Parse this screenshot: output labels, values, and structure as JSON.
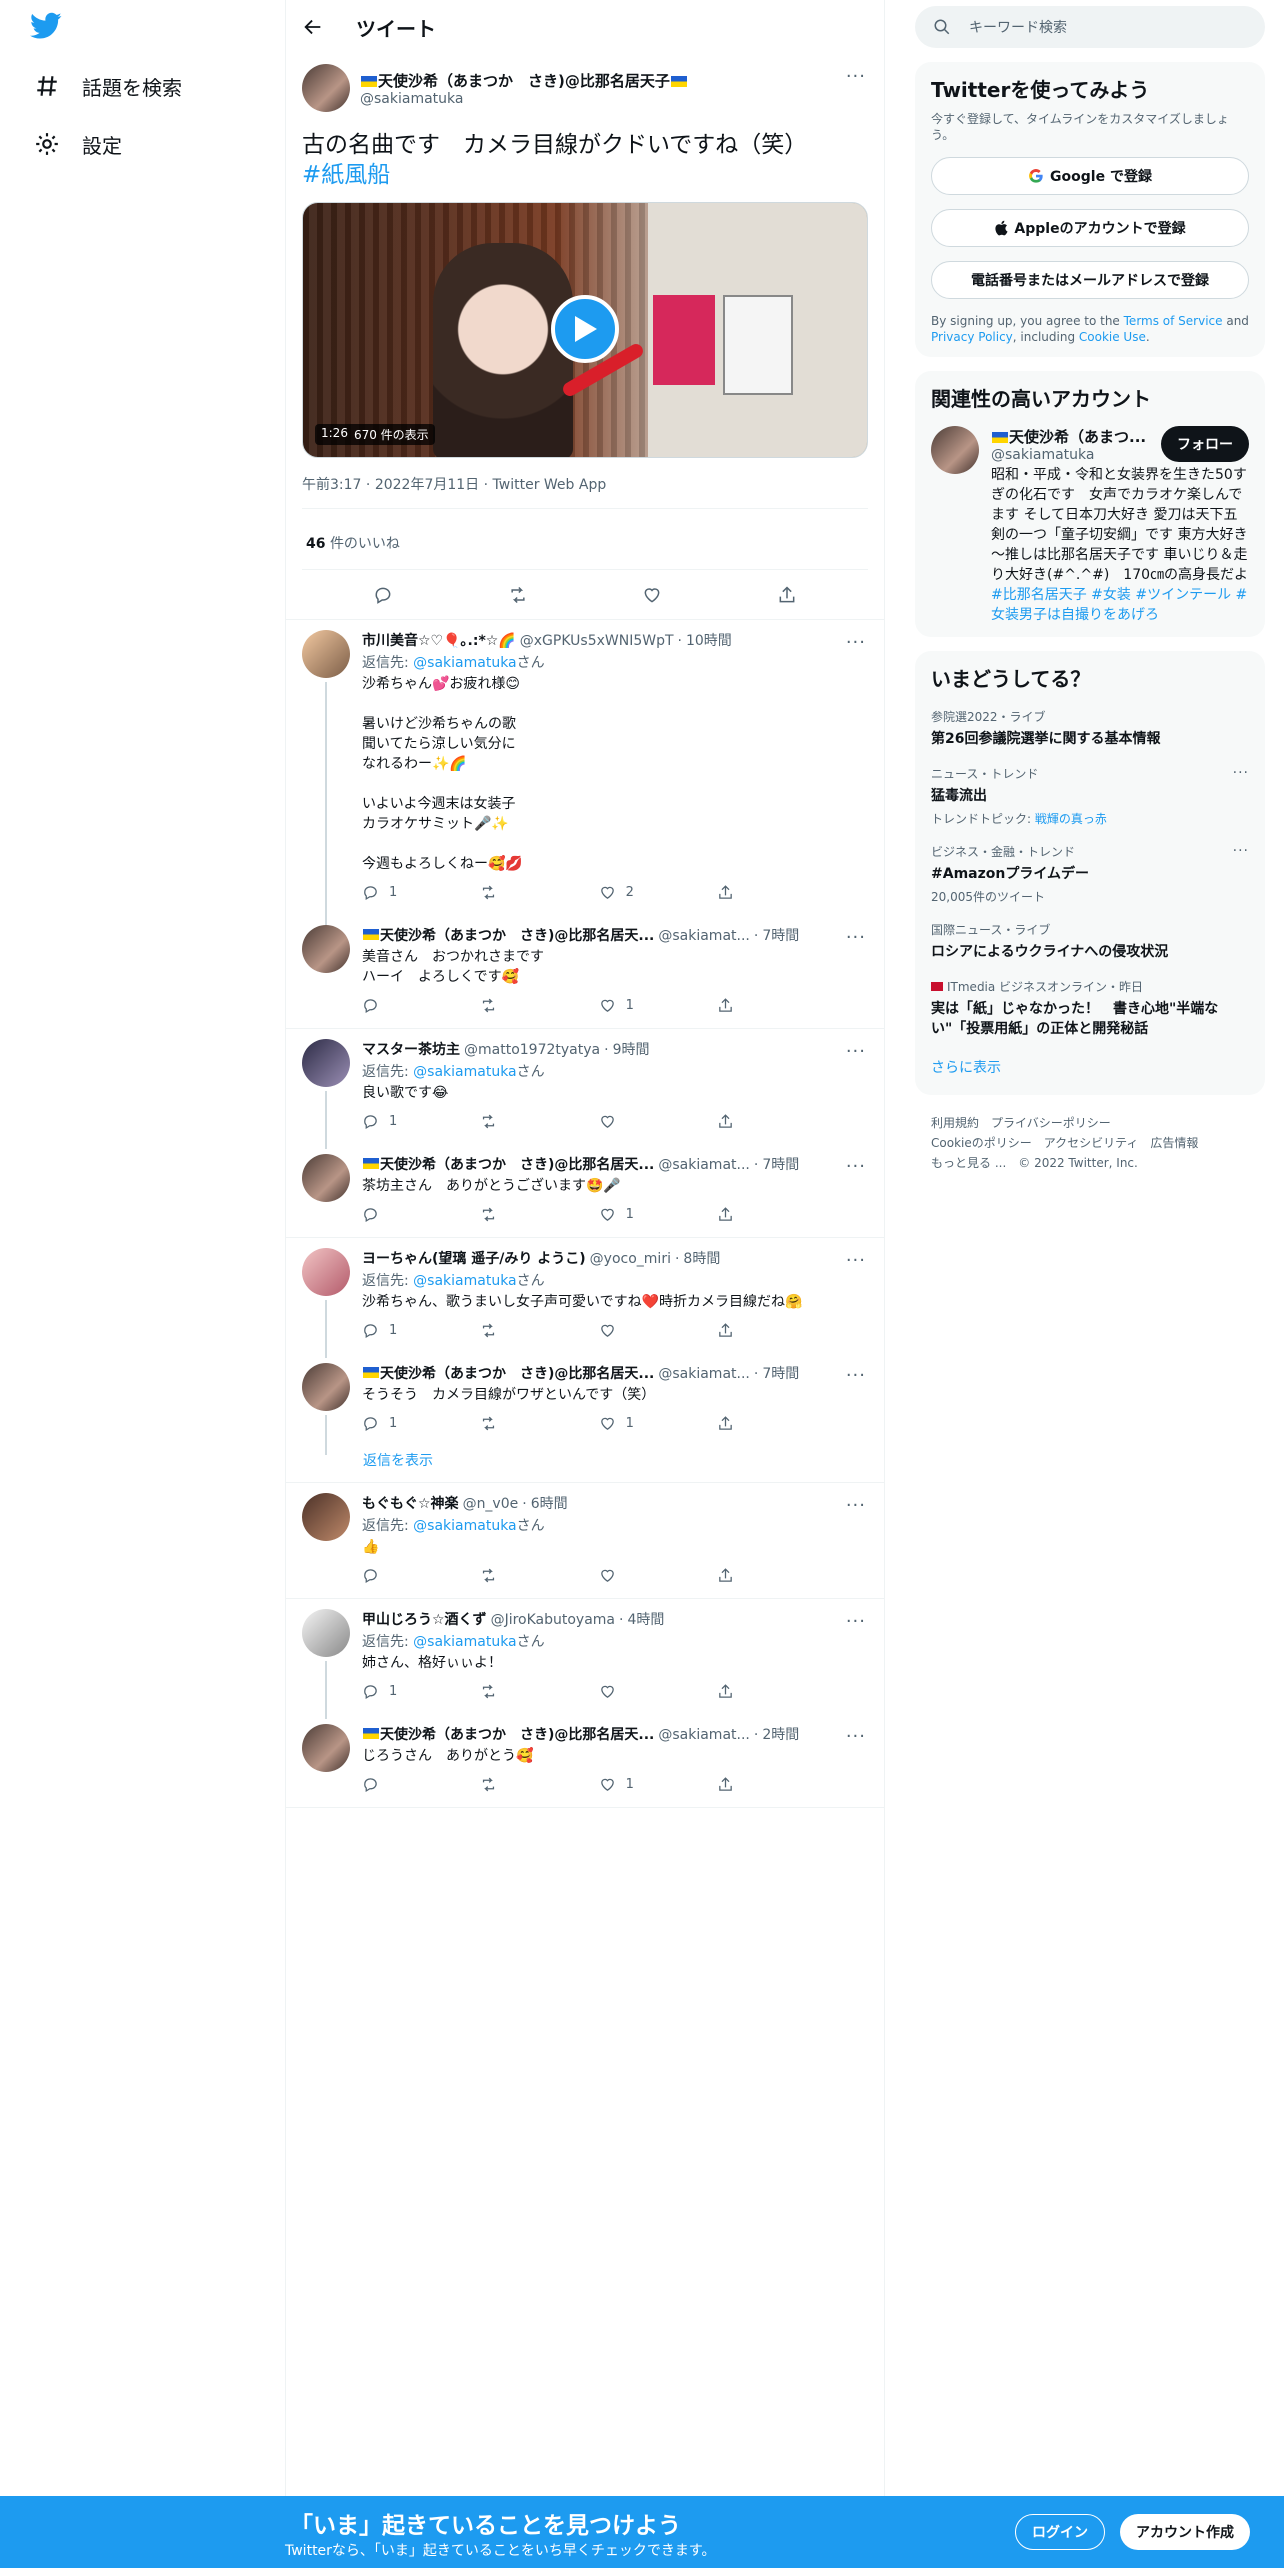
{
  "nav": {
    "explore_label": "話題を検索",
    "settings_label": "設定"
  },
  "header": {
    "title": "ツイート"
  },
  "main_tweet": {
    "author_name": "天使沙希（あまつか　さき)@比那名居天子",
    "author_handle": "@sakiamatuka",
    "text": "古の名曲です　カメラ目線がクドいですね（笑）",
    "hashtag": "#紙風船",
    "video_duration": "1:26",
    "video_views": "670 件の表示",
    "time": "午前3:17",
    "date": "2022年7月11日",
    "source": "Twitter Web App",
    "likes_count": "46",
    "likes_label": "件のいいね"
  },
  "replies": [
    {
      "name": "市川美音☆♡🎈｡.:*☆🌈",
      "handle": "@xGPKUs5xWNI5WpT",
      "time": "10時間",
      "reply_prefix": "返信先: ",
      "reply_to": "@sakiamatuka",
      "reply_suffix": "さん",
      "text": "沙希ちゃん💕お疲れ様😊\n\n暑いけど沙希ちゃんの歌\n聞いてたら涼しい気分に\nなれるわー✨🌈\n\nいよいよ今週末は女装子\nカラオケサミット🎤✨\n\n今週もよろしくねー🥰💋",
      "replies": "1",
      "retweets": "",
      "likes": "2"
    },
    {
      "name": "天使沙希（あまつか　さき)@比那名居天...",
      "handle": "@sakiamat...",
      "time": "7時間",
      "text": "美音さん　おつかれさまです\nハーイ　よろしくです🥰",
      "replies": "",
      "retweets": "",
      "likes": "1"
    },
    {
      "name": "マスター茶坊主",
      "handle": "@matto1972tyatya",
      "time": "9時間",
      "reply_prefix": "返信先: ",
      "reply_to": "@sakiamatuka",
      "reply_suffix": "さん",
      "text": "良い歌です😂",
      "replies": "1",
      "retweets": "",
      "likes": ""
    },
    {
      "name": "天使沙希（あまつか　さき)@比那名居天...",
      "handle": "@sakiamat...",
      "time": "7時間",
      "text": "茶坊主さん　ありがとうございます🤩🎤",
      "replies": "",
      "retweets": "",
      "likes": "1"
    },
    {
      "name": "ヨーちゃん(望璃 遥子/みり ようこ)",
      "handle": "@yoco_miri",
      "time": "8時間",
      "reply_prefix": "返信先: ",
      "reply_to": "@sakiamatuka",
      "reply_suffix": "さん",
      "text": "沙希ちゃん、歌うまいし女子声可愛いですね❤️時折カメラ目線だね🤗",
      "replies": "1",
      "retweets": "",
      "likes": ""
    },
    {
      "name": "天使沙希（あまつか　さき)@比那名居天...",
      "handle": "@sakiamat...",
      "time": "7時間",
      "text": "そうそう　カメラ目線がワザといんです（笑）",
      "replies": "1",
      "retweets": "",
      "likes": "1"
    },
    {
      "name": "もぐもぐ☆神楽",
      "handle": "@n_v0e",
      "time": "6時間",
      "reply_prefix": "返信先: ",
      "reply_to": "@sakiamatuka",
      "reply_suffix": "さん",
      "text": "👍",
      "replies": "",
      "retweets": "",
      "likes": ""
    },
    {
      "name": "甲山じろう☆酒くず",
      "handle": "@JiroKabutoyama",
      "time": "4時間",
      "reply_prefix": "返信先: ",
      "reply_to": "@sakiamatuka",
      "reply_suffix": "さん",
      "text": "姉さん、格好ぃぃよ！",
      "replies": "1",
      "retweets": "",
      "likes": ""
    },
    {
      "name": "天使沙希（あまつか　さき)@比那名居天...",
      "handle": "@sakiamat...",
      "time": "2時間",
      "text": "じろうさん　ありがとう🥰",
      "replies": "",
      "retweets": "",
      "likes": "1"
    }
  ],
  "show_replies_label": "返信を表示",
  "more_glyph": "···",
  "time_sep": "·",
  "right": {
    "search_placeholder": "キーワード検索",
    "signup_card": {
      "title": "Twitterを使ってみよう",
      "subtitle": "今すぐ登録して、タイムラインをカスタマイズしましょう。",
      "google_btn": "Google で登録",
      "apple_btn": "Appleのアカウントで登録",
      "phone_btn": "電話番号またはメールアドレスで登録",
      "legal_pre": "By signing up, you agree to the ",
      "terms": "Terms of Service",
      "legal_and": " and ",
      "privacy": "Privacy Policy",
      "legal_including": ", including ",
      "cookie": "Cookie Use",
      "legal_end": "."
    },
    "related_card": {
      "title": "関連性の高いアカウント",
      "name": "天使沙希（あまつ...",
      "handle": "@sakiamatuka",
      "follow_btn": "フォロー",
      "bio_text": "昭和・平成・令和と女装界を生きた50すぎの化石です　女声でカラオケ楽しんでます そして日本刀大好き 愛刀は天下五剣の一つ「童子切安綱」です 東方大好き～推しは比那名居天子です 車いじり＆走り大好き(#^.^#)　170㎝の高身長だよ ",
      "bio_tags": "#比那名居天子 #女装 #ツインテール #女装男子は自撮りをあげろ"
    },
    "trends_card": {
      "title": "いまどうしてる？",
      "items": [
        {
          "context": "参院選2022・ライブ",
          "title": "第26回参議院選挙に関する基本情報",
          "extra": ""
        },
        {
          "context": "ニュース・トレンド",
          "title": "猛毒流出",
          "extra_prefix": "トレンドトピック: ",
          "extra_link": "戦輝の真っ赤"
        },
        {
          "context": "ビジネス・金融・トレンド",
          "title": "#Amazonプライムデー",
          "extra": "20,005件のツイート"
        },
        {
          "context": "国際ニュース・ライブ",
          "title": "ロシアによるウクライナへの侵攻状況",
          "extra": ""
        },
        {
          "context": "ITmedia ビジネスオンライン・昨日",
          "title": "実は「紙」じゃなかった！　書き心地\"半端ない\"「投票用紙」の正体と開発秘話",
          "extra": ""
        }
      ],
      "show_more": "さらに表示"
    },
    "footer": {
      "line1": "利用規約　プライバシーポリシー",
      "line2": "Cookieのポリシー　アクセシビリティ　広告情報",
      "line3": "もっと見る ...　© 2022 Twitter, Inc."
    }
  },
  "bottom_bar": {
    "title": "「いま」起きていることを見つけよう",
    "subtitle": "Twitterなら、「いま」起きていることをいち早くチェックできます。",
    "login_btn": "ログイン",
    "signup_btn": "アカウント作成"
  },
  "colors": {
    "brand": "#1d9bf0",
    "text": "#0f1419",
    "secondary": "#536471"
  }
}
